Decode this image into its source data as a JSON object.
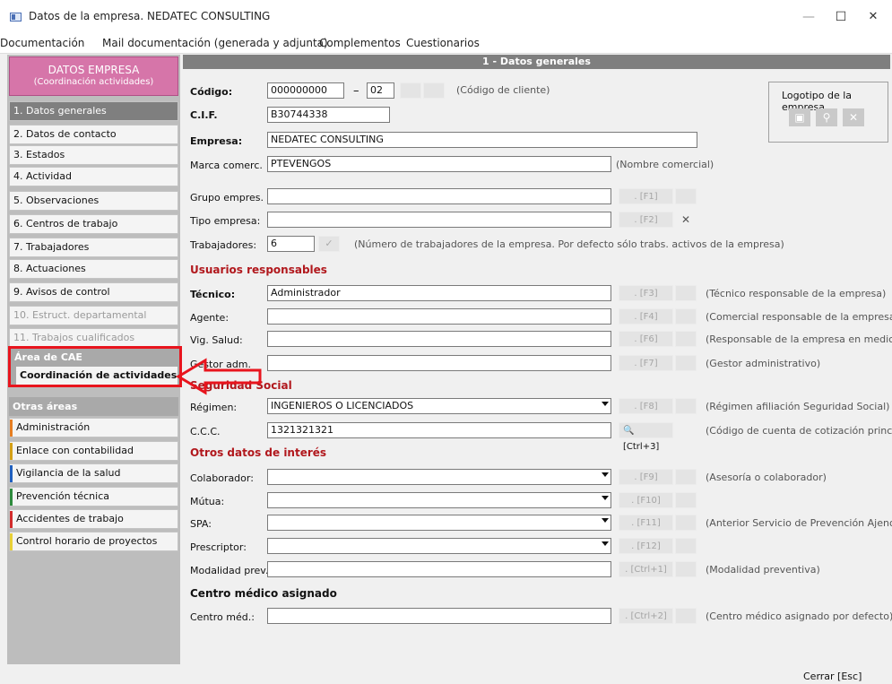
{
  "window": {
    "title": "Datos de la empresa. NEDATEC CONSULTING",
    "min": "—",
    "max": "☐",
    "close": "✕"
  },
  "menu": [
    "Documentación",
    "Mail documentación (generada y adjunta)",
    "Complementos",
    "Cuestionarios"
  ],
  "sidebar": {
    "header_title": "DATOS EMPRESA",
    "header_sub": "(Coordinación actividades)",
    "items": [
      "1. Datos generales",
      "2. Datos de contacto",
      "3. Estados",
      "4. Actividad",
      "5. Observaciones",
      "6. Centros de trabajo",
      "7. Trabajadores",
      "8. Actuaciones",
      "9. Avisos de control",
      "10. Estruct. departamental",
      "11. Trabajos cualificados"
    ],
    "cae_title": "Área de CAE",
    "cae_item": "Coordinación de actividades",
    "otras_title": "Otras áreas",
    "otras": [
      "Administración",
      "Enlace con contabilidad",
      "Vigilancia de la salud",
      "Prevención técnica",
      "Accidentes de trabajo",
      "Control horario de proyectos"
    ],
    "otras_colors": [
      "#e67e22",
      "#d4a017",
      "#1f5fbf",
      "#2e8b3d",
      "#d22b2b",
      "#e8d038"
    ]
  },
  "main": {
    "header": "1 - Datos generales",
    "codigo_lbl": "Código:",
    "codigo_val": "000000000",
    "codigo_dash": "–",
    "codigo_suf": "02",
    "codigo_note": "(Código de cliente)",
    "cif_lbl": "C.I.F.",
    "cif_val": "B30744338",
    "empresa_lbl": "Empresa:",
    "empresa_val": "NEDATEC CONSULTING",
    "marca_lbl": "Marca comerc.",
    "marca_val": "PTEVENGOS",
    "marca_note": "(Nombre comercial)",
    "grupo_lbl": "Grupo empres.",
    "grupo_btn": ". [F1]",
    "tipo_lbl": "Tipo empresa:",
    "tipo_btn": ". [F2]",
    "trab_lbl": "Trabajadores:",
    "trab_val": "6",
    "trab_note": "(Número de trabajadores de la empresa. Por defecto sólo trabs. activos de la empresa)",
    "logo_lbl": "Logotipo de la empresa",
    "usuarios_title": "Usuarios responsables",
    "tecnico_lbl": "Técnico:",
    "tecnico_val": "Administrador",
    "tecnico_btn": ". [F3]",
    "tecnico_note": "(Técnico responsable de la empresa)",
    "agente_lbl": "Agente:",
    "agente_btn": ". [F4]",
    "agente_note": "(Comercial responsable de la empresa)",
    "vig_lbl": "Vig. Salud:",
    "vig_btn": ". [F6]",
    "vig_note": "(Responsable de la empresa en medicina)",
    "gestor_lbl": "Gestor adm.",
    "gestor_btn": ". [F7]",
    "gestor_note": "(Gestor administrativo)",
    "ss_title": "Seguridad Social",
    "regimen_lbl": "Régimen:",
    "regimen_val": "INGENIEROS O LICENCIADOS",
    "regimen_btn": ". [F8]",
    "regimen_note": "(Régimen afiliación Seguridad Social)",
    "ccc_lbl": "C.C.C.",
    "ccc_val": "1321321321",
    "ccc_btn": "[Ctrl+3]",
    "ccc_note": "(Código de cuenta de cotización principal)",
    "otros_title": "Otros datos de interés",
    "colab_lbl": "Colaborador:",
    "colab_btn": ". [F9]",
    "colab_note": "(Asesoría o colaborador)",
    "mutua_lbl": "Mútua:",
    "mutua_btn": ". [F10]",
    "spa_lbl": "SPA:",
    "spa_btn": ". [F11]",
    "spa_note": "(Anterior Servicio de Prevención Ajeno)",
    "prescriptor_lbl": "Prescriptor:",
    "prescriptor_btn": ". [F12]",
    "modalidad_lbl": "Modalidad prev.:",
    "modalidad_btn": ". [Ctrl+1]",
    "modalidad_note": "(Modalidad preventiva)",
    "centro_title": "Centro médico asignado",
    "centro_lbl": "Centro méd.:",
    "centro_btn": ". [Ctrl+2]",
    "centro_note": "(Centro médico asignado por defecto)"
  },
  "footer": {
    "cerrar": "Cerrar [Esc]"
  }
}
